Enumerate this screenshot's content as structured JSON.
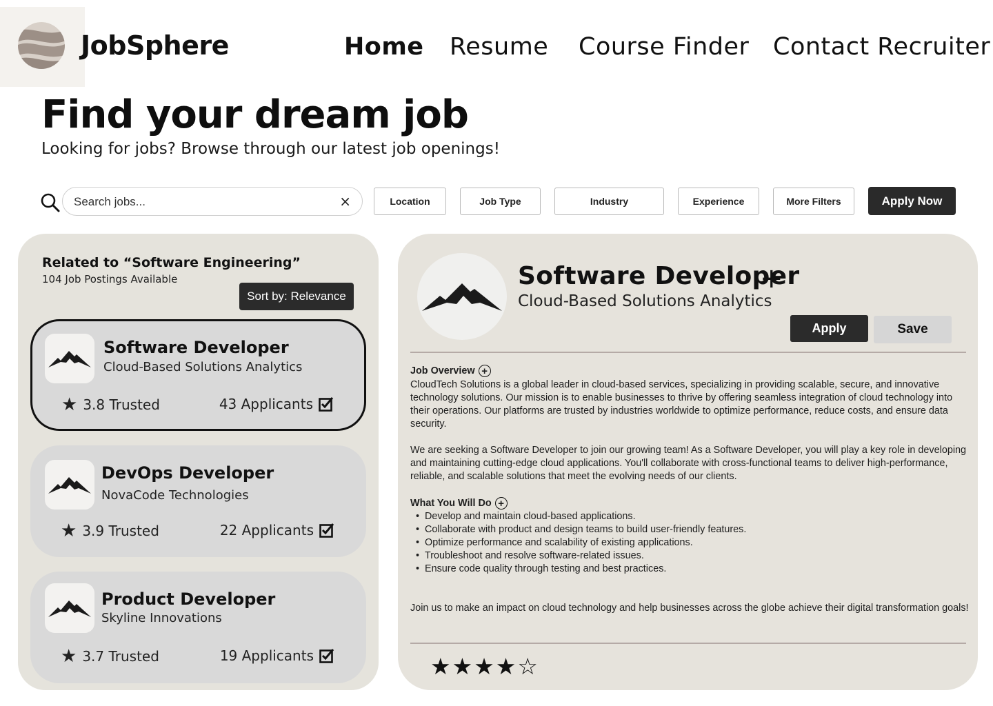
{
  "brand": {
    "name": "JobSphere",
    "logo_icon": "sphere-logo-icon"
  },
  "nav": [
    {
      "label": "Home",
      "active": true
    },
    {
      "label": "Resume",
      "active": false
    },
    {
      "label": "Course Finder",
      "active": false
    },
    {
      "label": "Contact Recruiter",
      "active": false
    }
  ],
  "hero": {
    "title": "Find your dream job",
    "subtitle": "Looking for jobs? Browse through our latest job openings!"
  },
  "search": {
    "placeholder": "Search jobs...",
    "value": "",
    "clear_label": "×"
  },
  "filters": [
    "Location",
    "Job Type",
    "Industry",
    "Experience",
    "More Filters"
  ],
  "apply_now_label": "Apply Now",
  "results": {
    "heading": "Related to “Software Engineering”",
    "count": "104 Job Postings Available",
    "sort_label": "Sort by: Relevance",
    "cards": [
      {
        "title": "Software Developer",
        "company": "Cloud-Based Solutions Analytics",
        "rating": "3.8 Trusted",
        "applicants": "43 Applicants",
        "selected": true
      },
      {
        "title": "DevOps Developer",
        "company": "NovaCode Technologies",
        "rating": "3.9 Trusted",
        "applicants": "22 Applicants",
        "selected": false
      },
      {
        "title": "Product Developer",
        "company": "Skyline Innovations",
        "rating": "3.7 Trusted",
        "applicants": "19 Applicants",
        "selected": false
      }
    ]
  },
  "detail": {
    "title": "Software Developer",
    "company": "Cloud-Based Solutions Analytics",
    "apply_label": "Apply",
    "save_label": "Save",
    "overview_heading": "Job Overview",
    "overview_p1": "CloudTech Solutions is a global leader in cloud-based services, specializing in providing scalable, secure, and innovative technology solutions. Our mission is to enable businesses to thrive by offering seamless integration of cloud technology into their operations. Our platforms are trusted by industries worldwide to optimize performance, reduce costs, and ensure data security.",
    "overview_p2": "We are seeking a Software Developer to join our growing team! As a Software Developer, you will play a key role in developing and maintaining cutting-edge cloud applications. You'll collaborate with cross-functional teams to deliver high-performance, reliable, and scalable solutions that meet the evolving needs of our clients.",
    "todo_heading": "What You Will Do",
    "todo": [
      "Develop and maintain cloud-based applications.",
      "Collaborate with product and design teams to build user-friendly features.",
      "Optimize performance and scalability of existing applications.",
      "Troubleshoot and resolve software-related issues.",
      "Ensure code quality through testing and best practices."
    ],
    "closing": "Join us to make an impact on cloud technology and help businesses across the globe achieve their digital transformation goals!",
    "rating_stars": 4,
    "rating_max": 5
  },
  "colors": {
    "panel": "#e5e3dc",
    "card": "#d9d9d9",
    "dark_button": "#2b2b2b",
    "divider": "#b5aaa6"
  }
}
